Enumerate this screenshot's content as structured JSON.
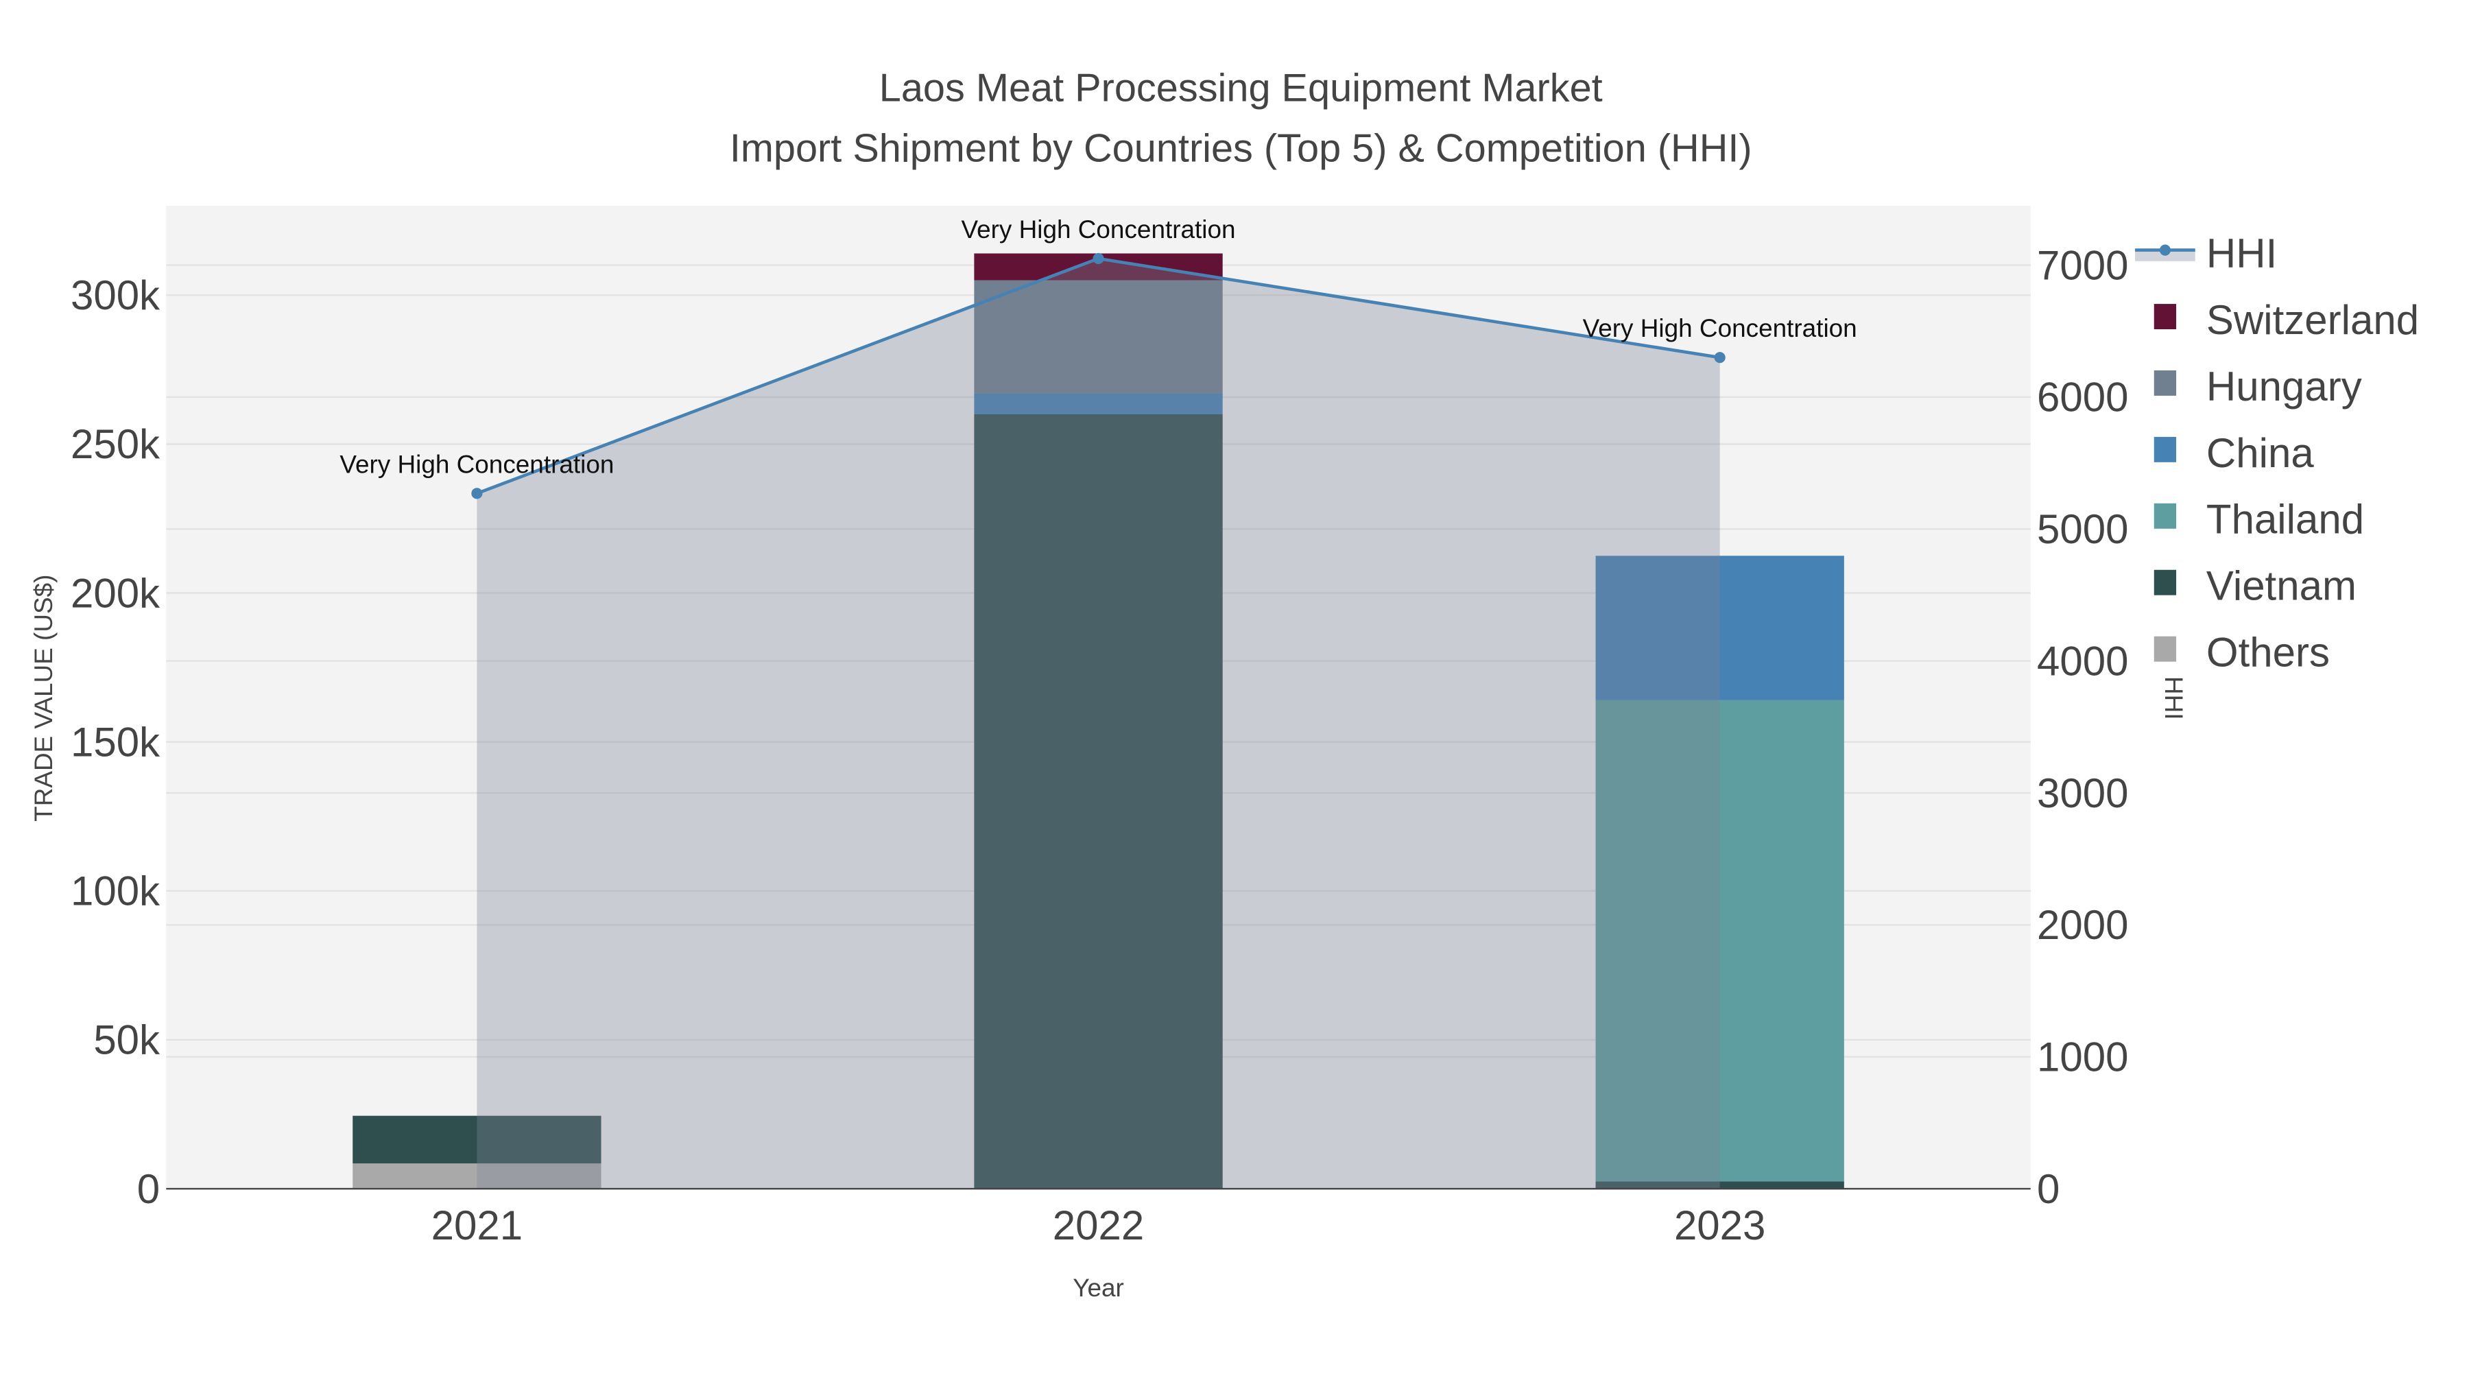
{
  "chart_data": {
    "type": "bar",
    "title_line1": "Laos Meat Processing Equipment Market",
    "title_line2": "Import Shipment by Countries (Top 5) & Competition (HHI)",
    "xlabel": "Year",
    "ylabel": "TRADE VALUE (US$)",
    "y2label": "HHI",
    "categories": [
      "2021",
      "2022",
      "2023"
    ],
    "ylim": [
      0,
      330000
    ],
    "y2lim": [
      0,
      7450
    ],
    "yticks": [
      0,
      50000,
      100000,
      150000,
      200000,
      250000,
      300000
    ],
    "ytick_labels": [
      "0",
      "50k",
      "100k",
      "150k",
      "200k",
      "250k",
      "300k"
    ],
    "y2ticks": [
      0,
      1000,
      2000,
      3000,
      4000,
      5000,
      6000,
      7000
    ],
    "y2tick_labels": [
      "0",
      "1000",
      "2000",
      "3000",
      "4000",
      "5000",
      "6000",
      "7000"
    ],
    "stack_order": [
      "Others",
      "Vietnam",
      "Thailand",
      "China",
      "Hungary",
      "Switzerland"
    ],
    "series": [
      {
        "name": "Others",
        "color": "#a9a9a9",
        "values": [
          8500,
          0,
          0
        ]
      },
      {
        "name": "Vietnam",
        "color": "#2f4f4f",
        "values": [
          16000,
          260000,
          2500
        ]
      },
      {
        "name": "Thailand",
        "color": "#5f9ea0",
        "values": [
          0,
          0,
          161500
        ]
      },
      {
        "name": "China",
        "color": "#4682b4",
        "values": [
          0,
          7000,
          48500
        ]
      },
      {
        "name": "Hungary",
        "color": "#708090",
        "values": [
          0,
          38000,
          0
        ]
      },
      {
        "name": "Switzerland",
        "color": "#621234",
        "values": [
          0,
          9000,
          0
        ]
      }
    ],
    "hhi": {
      "name": "HHI",
      "color": "#4682b4",
      "values": [
        5270,
        7050,
        6300
      ]
    },
    "annotations": [
      "Very High Concentration",
      "Very High Concentration",
      "Very High Concentration"
    ],
    "legend": [
      "HHI",
      "Switzerland",
      "Hungary",
      "China",
      "Thailand",
      "Vietnam",
      "Others"
    ],
    "legend_placement": "right",
    "grid": true
  }
}
